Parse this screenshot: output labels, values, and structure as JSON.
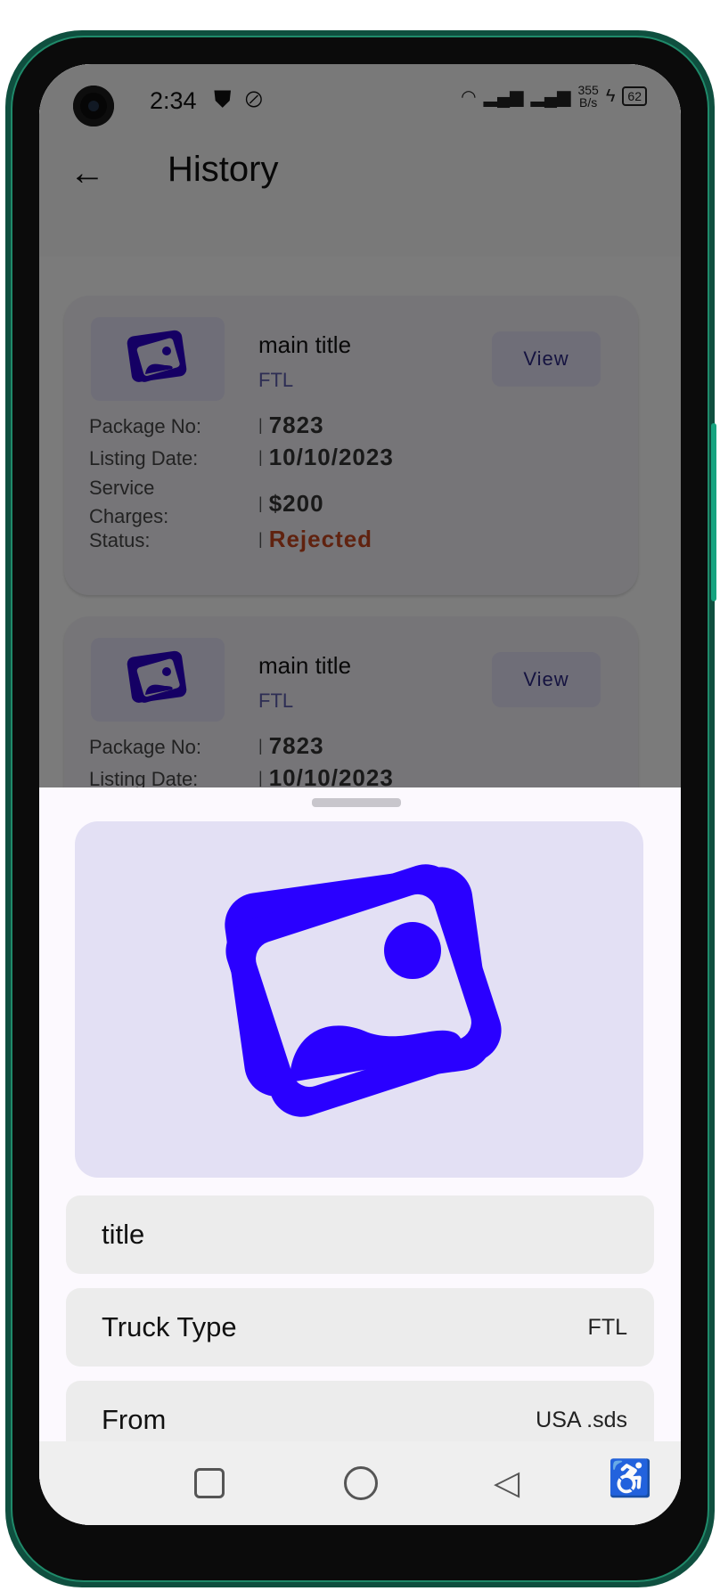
{
  "status_bar": {
    "time": "2:34",
    "net_speed": "355\nB/s",
    "battery": "62"
  },
  "app_bar": {
    "title": "History",
    "back_icon": "arrow-left-icon"
  },
  "cards": [
    {
      "main_title": "main title",
      "subtitle": "FTL",
      "view_label": "View",
      "package_label": "Package No:",
      "package_value": "7823",
      "date_label": "Listing Date:",
      "date_value": "10/10/2023",
      "charges_label": "Service\nCharges:",
      "charges_value": "$200",
      "status_label": "Status:",
      "status_value": "Rejected"
    },
    {
      "main_title": "main title",
      "subtitle": "FTL",
      "view_label": "View",
      "package_label": "Package No:",
      "package_value": "7823",
      "date_label": "Listing Date:",
      "date_value": "10/10/2023"
    }
  ],
  "sheet": {
    "image_icon": "images-icon",
    "title": "title",
    "truck_label": "Truck Type",
    "truck_value": "FTL",
    "from_label": "From",
    "from_value": "USA .sds"
  },
  "colors": {
    "accent": "#2a00ff",
    "rejected": "#c0451e",
    "sheet_bg": "#fcf9fe"
  }
}
